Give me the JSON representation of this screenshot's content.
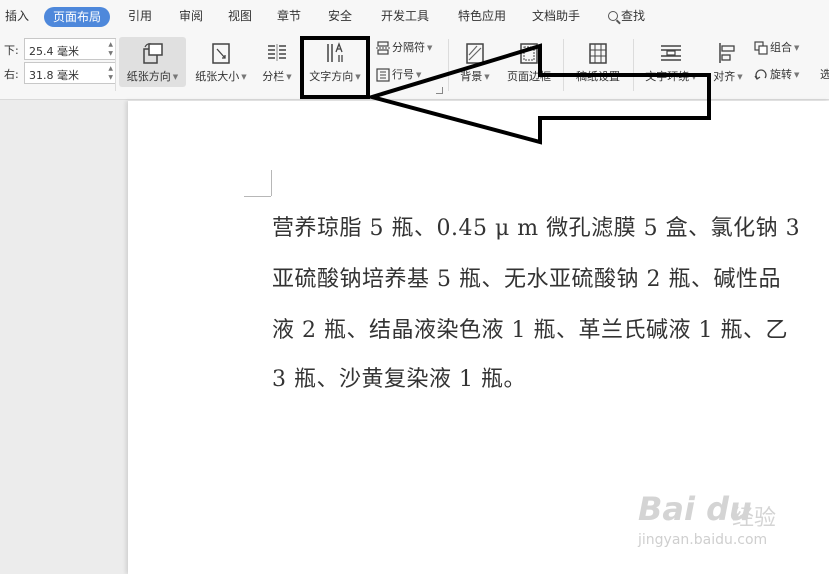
{
  "menu_tabs": [
    "插入",
    "页面布局",
    "引用",
    "审阅",
    "视图",
    "章节",
    "安全",
    "开发工具",
    "特色应用",
    "文档助手",
    "查找"
  ],
  "active_tab": "页面布局",
  "margins": {
    "bottom_label": "下:",
    "bottom_value": "25.4 毫米",
    "right_label": "右:",
    "right_value": "31.8 毫米"
  },
  "ribbon": {
    "orientation": "纸张方向",
    "paper_size": "纸张大小",
    "columns": "分栏",
    "text_direction": "文字方向",
    "section_break": "分隔符",
    "line_number": "行号",
    "background": "背景",
    "page_border": "页面边框",
    "grid_settings": "稿纸设置",
    "text_wrap": "文字环绕",
    "align": "对齐",
    "group": "组合",
    "rotate": "旋转",
    "select_pane": "选"
  },
  "document": {
    "lines": [
      "营养琼脂 5 瓶、0.45 μ m 微孔滤膜 5 盒、氯化钠 3",
      "亚硫酸钠培养基 5 瓶、无水亚硫酸钠 2 瓶、碱性品",
      "液 2 瓶、结晶液染色液 1 瓶、革兰氏碱液 1 瓶、乙",
      "3 瓶、沙黄复染液 1 瓶。"
    ]
  },
  "watermark": {
    "brand": "Bai du",
    "brand_cn": "经验",
    "url": "jingyan.baidu.com"
  },
  "colors": {
    "active_tab_bg": "#4e88db",
    "annotation": "#000000"
  }
}
